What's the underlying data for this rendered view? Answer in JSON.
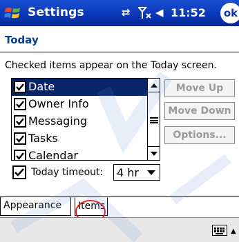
{
  "titlebar": {
    "title": "Settings",
    "clock": "11:52",
    "ok_label": "ok",
    "icons": [
      "start-menu-icon",
      "sync-icon",
      "signal-off-icon",
      "volume-icon"
    ]
  },
  "header": {
    "title": "Today"
  },
  "instructions": "Checked items appear on the Today screen.",
  "list": {
    "items": [
      {
        "label": "Date",
        "checked": true,
        "selected": true
      },
      {
        "label": "Owner Info",
        "checked": true,
        "selected": false
      },
      {
        "label": "Messaging",
        "checked": true,
        "selected": false
      },
      {
        "label": "Tasks",
        "checked": true,
        "selected": false
      },
      {
        "label": "Calendar",
        "checked": true,
        "selected": false
      }
    ]
  },
  "buttons": {
    "move_up": "Move Up",
    "move_down": "Move Down",
    "options": "Options..."
  },
  "timeout": {
    "label": "Today timeout:",
    "checked": true,
    "value": "4 hr"
  },
  "tabs": [
    {
      "label": "Appearance",
      "active": false
    },
    {
      "label": "Items",
      "active": true
    }
  ],
  "colors": {
    "title_bar": "#0a36b6",
    "header_text": "#0b3d91",
    "selection": "#0a246a",
    "highlight_circle": "#e51c1c"
  }
}
